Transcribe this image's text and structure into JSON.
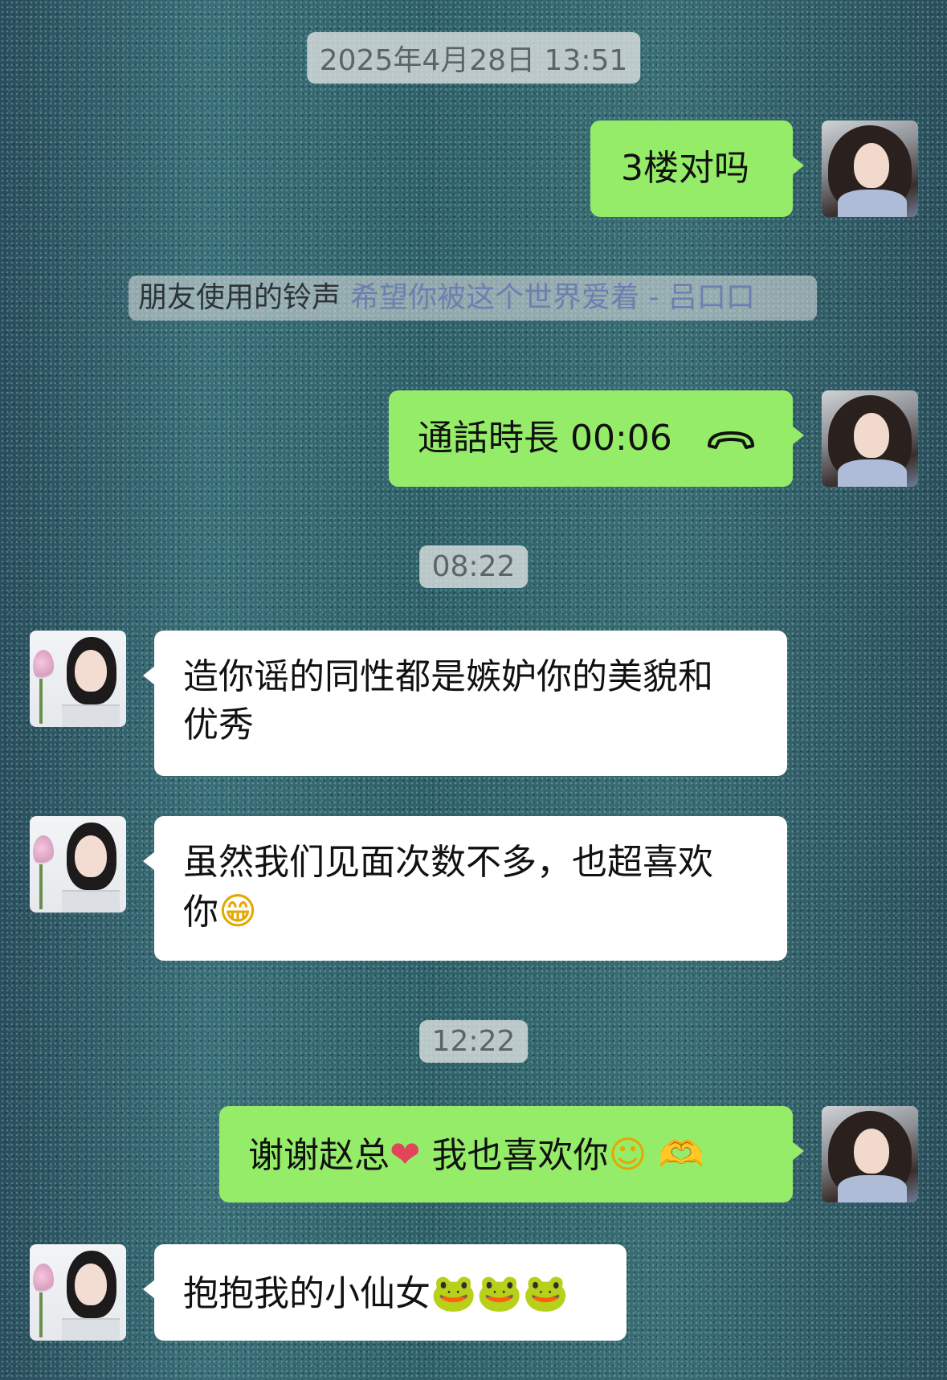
{
  "chat": {
    "timestamps": {
      "t1": "2025年4月28日 13:51",
      "t2": "08:22",
      "t3": "12:22"
    },
    "ringtone": {
      "label": "朋友使用的铃声",
      "song": "希望你被这个世界爱着 - 吕口口"
    },
    "messages": {
      "m1": {
        "text": "3楼对吗"
      },
      "m2": {
        "text": "通話時長 00:06"
      },
      "m3": {
        "text": "造你谣的同性都是嫉妒你的美貌和\n优秀"
      },
      "m4": {
        "text": "虽然我们见面次数不多，也超喜欢\n你",
        "emoji": "😁"
      },
      "m5": {
        "text_a": "谢谢赵总",
        "emoji_heart": "❤",
        "text_b": "我也喜欢你",
        "emoji_smile": "☺",
        "emoji_palms": "🫶"
      },
      "m6": {
        "text": "抱抱我的小仙女",
        "emoji": "🐸🐸🐸"
      }
    }
  },
  "colors": {
    "own_bubble": "#95ec69",
    "other_bubble": "#ffffff",
    "song_link": "#6d7fb0"
  }
}
